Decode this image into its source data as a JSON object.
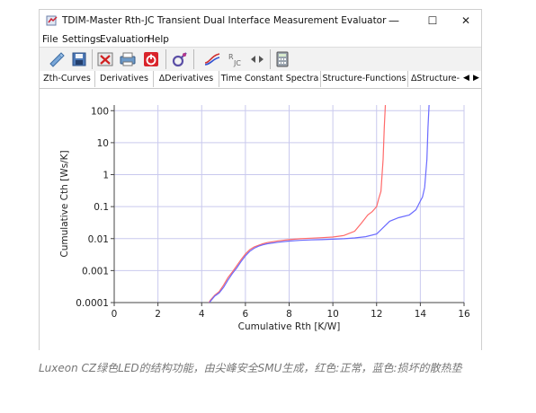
{
  "window": {
    "title": "TDIM-Master Rth-JC Transient Dual Interface Measurement Evaluator",
    "minimize_glyph": "—",
    "maximize_glyph": "☐",
    "close_glyph": "✕"
  },
  "menu": [
    {
      "label": "File"
    },
    {
      "label": "Settings"
    },
    {
      "label": "Evaluation"
    },
    {
      "label": "Help"
    }
  ],
  "toolbar": {
    "icons": [
      "open-folder-icon",
      "save-icon",
      "delete-icon",
      "print-icon",
      "power-icon",
      "settings-icon",
      "rth-jc-curves-icon",
      "rth-jc-icon",
      "move-cursor-icon",
      "calculator-icon"
    ]
  },
  "tabs": [
    {
      "label": "Zth-Curves"
    },
    {
      "label": "Derivatives"
    },
    {
      "label": "ΔDerivatives"
    },
    {
      "label": "Time Constant Spectra"
    },
    {
      "label": "Structure-Functions",
      "active": true
    },
    {
      "label": "ΔStructure-"
    }
  ],
  "tab_scroll": {
    "left": "◀",
    "right": "▶"
  },
  "chart_data": {
    "type": "line",
    "xlabel": "Cumulative Rth [K/W]",
    "ylabel": "Cumulative Cth [Ws/K]",
    "xlim": [
      0,
      16
    ],
    "ylim": [
      0.0001,
      150
    ],
    "yscale": "log",
    "xticks": [
      "0",
      "2",
      "4",
      "6",
      "8",
      "10",
      "12",
      "14",
      "16"
    ],
    "yticks": [
      "0.0001",
      "0.001",
      "0.01",
      "0.1",
      "1",
      "10",
      "100"
    ],
    "grid": true,
    "series": [
      {
        "color": "#ff6a6a",
        "x": [
          3.95,
          4.2,
          4.4,
          4.6,
          4.8,
          5.0,
          5.2,
          5.4,
          5.6,
          5.8,
          6.0,
          6.2,
          6.4,
          6.6,
          6.8,
          7.0,
          7.5,
          8.0,
          8.5,
          9.0,
          9.5,
          10.0,
          10.5,
          11.0,
          11.3,
          11.6,
          11.8,
          12.0,
          12.1,
          12.2,
          12.3,
          12.35,
          12.4
        ],
        "y": [
          6e-05,
          7e-05,
          0.00012,
          0.00017,
          0.00022,
          0.00035,
          0.0006,
          0.0009,
          0.0014,
          0.0022,
          0.0033,
          0.0045,
          0.0055,
          0.0062,
          0.0069,
          0.0075,
          0.0085,
          0.0093,
          0.0099,
          0.0103,
          0.0107,
          0.0112,
          0.0125,
          0.017,
          0.03,
          0.055,
          0.07,
          0.1,
          0.18,
          0.3,
          3.0,
          30,
          150
        ]
      },
      {
        "color": "#6a6aff",
        "x": [
          3.95,
          4.2,
          4.4,
          4.6,
          4.8,
          5.0,
          5.2,
          5.4,
          5.6,
          5.8,
          6.0,
          6.2,
          6.4,
          6.6,
          6.8,
          7.0,
          7.5,
          8.0,
          8.5,
          9.0,
          9.5,
          10.0,
          10.5,
          11.0,
          11.5,
          12.0,
          12.3,
          12.6,
          13.0,
          13.5,
          13.8,
          14.0,
          14.1,
          14.2,
          14.3,
          14.35,
          14.4
        ],
        "y": [
          6e-05,
          7e-05,
          0.00011,
          0.00016,
          0.0002,
          0.0003,
          0.0005,
          0.0008,
          0.0012,
          0.0019,
          0.0029,
          0.004,
          0.005,
          0.0058,
          0.0064,
          0.0069,
          0.0077,
          0.0084,
          0.0088,
          0.0091,
          0.0093,
          0.0096,
          0.0099,
          0.0105,
          0.0115,
          0.014,
          0.022,
          0.035,
          0.045,
          0.055,
          0.08,
          0.15,
          0.2,
          0.4,
          3.0,
          30,
          150
        ]
      }
    ]
  },
  "caption": "Luxeon CZ绿色LED的结构功能，由尖峰安全SMU生成，红色:正常，蓝色:损坏的散热垫"
}
